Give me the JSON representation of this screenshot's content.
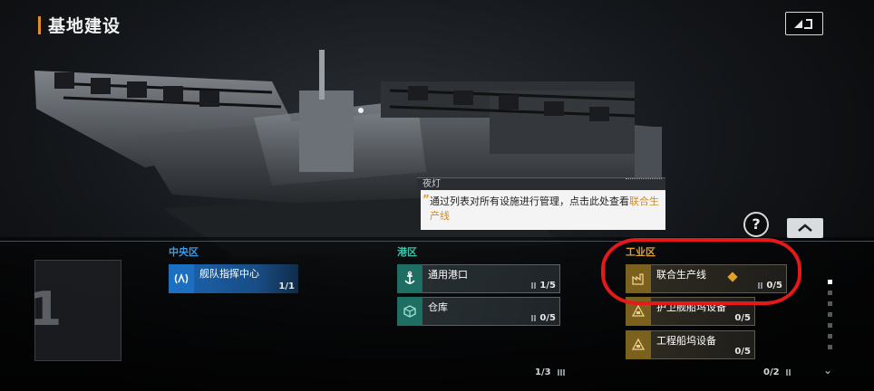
{
  "header": {
    "title": "基地建设"
  },
  "tooltip": {
    "speaker": "夜灯",
    "text_prefix": "通过列表对所有设施进行管理，点击此处查看",
    "text_highlight": "联合生产线",
    "highlight_color": "#d98a1c"
  },
  "floor": {
    "number": "1"
  },
  "sections": {
    "central": {
      "label": "中央区",
      "color": "#3a9be8",
      "items": [
        {
          "name": "舰队指挥中心",
          "count": "1/1",
          "icon": "signal-icon"
        }
      ]
    },
    "port": {
      "label": "港区",
      "color": "#3fc2a8",
      "items": [
        {
          "name": "通用港口",
          "count": "1/5",
          "icon": "anchor-icon"
        },
        {
          "name": "仓库",
          "count": "0/5",
          "icon": "cube-icon"
        }
      ],
      "footer": "1/3"
    },
    "industry": {
      "label": "工业区",
      "color": "#e3a02a",
      "items": [
        {
          "name": "联合生产线",
          "count": "0/5",
          "icon": "factory-icon"
        },
        {
          "name": "护卫舰船坞设备",
          "count": "0/5",
          "icon": "dock-icon"
        },
        {
          "name": "工程船坞设备",
          "count": "0/5",
          "icon": "dock-icon"
        }
      ],
      "footer": "0/2"
    }
  },
  "colors": {
    "accent": "#e38c2a",
    "highlight_ring": "#e51919"
  }
}
